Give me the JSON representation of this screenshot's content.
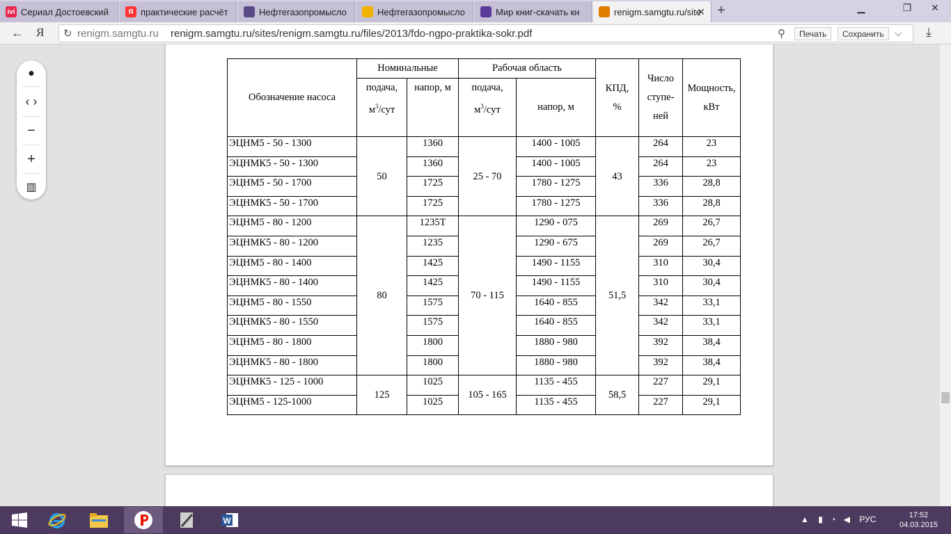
{
  "browser": {
    "tabs": [
      {
        "title": "Сериал Достоевский",
        "favicon": "ivi-icon",
        "favicon_text": "ivi",
        "color": "#e8264c"
      },
      {
        "title": "практические расчёт",
        "favicon": "yandex-icon",
        "favicon_text": "Я",
        "color": "#f33"
      },
      {
        "title": "Нефтегазопромысло",
        "favicon": "book-icon",
        "favicon_text": "",
        "color": "#5b4a8a"
      },
      {
        "title": "Нефтегазопромысло",
        "favicon": "smiley-icon",
        "favicon_text": "",
        "color": "#f0b400"
      },
      {
        "title": "Мир книг-скачать кн",
        "favicon": "books-icon",
        "favicon_text": "",
        "color": "#5b3a9a"
      },
      {
        "title": "renigm.samgtu.ru/site",
        "favicon": "sun-icon",
        "favicon_text": "",
        "color": "#e07b00",
        "active": true
      }
    ],
    "address": {
      "domain": "renigm.samgtu.ru",
      "url": "renigm.samgtu.ru/sites/renigm.samgtu.ru/files/2013/fdo-ngpo-praktika-sokr.pdf",
      "print_label": "Печать",
      "save_label": "Сохранить"
    }
  },
  "pump_table": {
    "headers": {
      "designation": "Обозначение насоса",
      "nominal": "Номинальные",
      "work_area": "Рабочая область",
      "efficiency": "КПД, %",
      "stages": "Число ступе-ней",
      "power": "Мощность, кВт",
      "flow": "подача, м3/сут",
      "head": "напор, м"
    },
    "groups": [
      {
        "nominal_flow": "50",
        "work_flow": "25 - 70",
        "efficiency": "43",
        "rows": [
          {
            "name": "ЭЦНМ5 - 50 - 1300",
            "head": "1360",
            "work_head": "1400 - 1005",
            "stages": "264",
            "power": "23"
          },
          {
            "name": "ЭЦНМК5 - 50 - 1300",
            "head": "1360",
            "work_head": "1400 - 1005",
            "stages": "264",
            "power": "23"
          },
          {
            "name": "ЭЦНМ5 - 50 - 1700",
            "head": "1725",
            "work_head": "1780 - 1275",
            "stages": "336",
            "power": "28,8"
          },
          {
            "name": "ЭЦНМК5 - 50 - 1700",
            "head": "1725",
            "work_head": "1780 - 1275",
            "stages": "336",
            "power": "28,8"
          }
        ]
      },
      {
        "nominal_flow": "80",
        "work_flow": "70 - 115",
        "efficiency": "51,5",
        "rows": [
          {
            "name": "ЭЦНМ5 - 80 - 1200",
            "head": "1235Т",
            "work_head": "1290 - 075",
            "stages": "269",
            "power": "26,7"
          },
          {
            "name": "ЭЦНМК5 - 80 - 1200",
            "head": "1235",
            "work_head": "1290 - 675",
            "stages": "269",
            "power": "26,7"
          },
          {
            "name": "ЭЦНМ5 - 80 - 1400",
            "head": "1425",
            "work_head": "1490 - 1155",
            "stages": "310",
            "power": "30,4"
          },
          {
            "name": "ЭЦНМК5 - 80 - 1400",
            "head": "1425",
            "work_head": "1490 - 1155",
            "stages": "310",
            "power": "30,4"
          },
          {
            "name": "ЭЦНМ5 - 80 - 1550",
            "head": "1575",
            "work_head": "1640 - 855",
            "stages": "342",
            "power": "33,1"
          },
          {
            "name": "ЭЦНМК5 - 80 - 1550",
            "head": "1575",
            "work_head": "1640 - 855",
            "stages": "342",
            "power": "33,1"
          },
          {
            "name": "ЭЦНМ5 - 80 - 1800",
            "head": "1800",
            "work_head": "1880 - 980",
            "stages": "392",
            "power": "38,4"
          },
          {
            "name": "ЭЦНМК5 - 80 - 1800",
            "head": "1800",
            "work_head": "1880 - 980",
            "stages": "392",
            "power": "38,4"
          }
        ]
      },
      {
        "nominal_flow": "125",
        "work_flow": "105 - 165",
        "efficiency": "58,5",
        "rows": [
          {
            "name": "ЭЦНМК5 - 125 - 1000",
            "head": "1025",
            "work_head": "1135 - 455",
            "stages": "227",
            "power": "29,1"
          },
          {
            "name": "ЭЦНМ5 - 125-1000",
            "head": "1025",
            "work_head": "1135 - 455",
            "stages": "227",
            "power": "29,1"
          }
        ]
      }
    ]
  },
  "taskbar": {
    "apps": [
      "windows-start-icon",
      "internet-explorer-icon",
      "file-explorer-icon",
      "yandex-browser-icon",
      "notepad-icon",
      "word-icon"
    ],
    "language": "РУС",
    "time": "17:52",
    "date": "04.03.2015"
  }
}
